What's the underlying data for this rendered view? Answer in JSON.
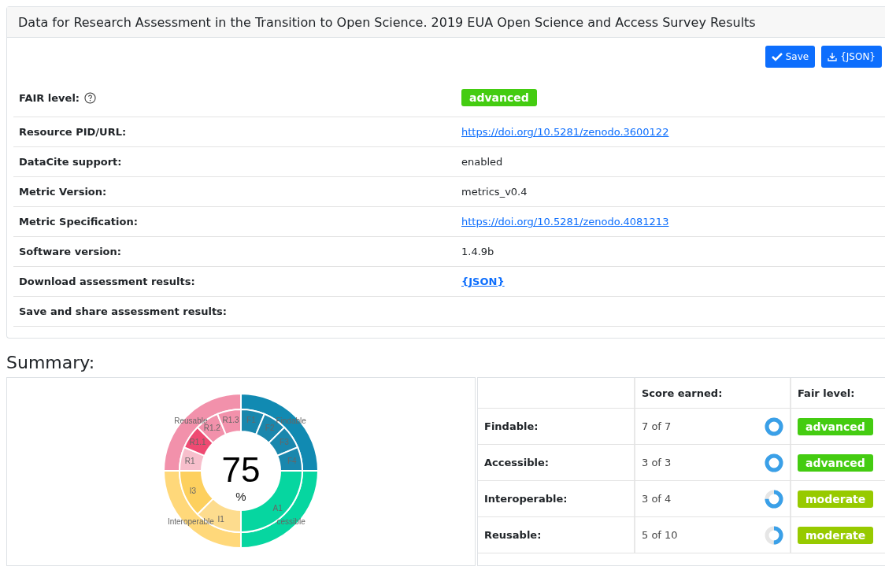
{
  "card_title": "Data for Research Assessment in the Transition to Open Science. 2019 EUA Open Science and Access Survey Results",
  "buttons": [
    {
      "kind": "save",
      "label": "Save"
    },
    {
      "kind": "download",
      "label": "{JSON}"
    }
  ],
  "details": [
    {
      "label": "FAIR level:",
      "kind": "badge",
      "value": "advanced",
      "help": true,
      "color": "#44cc11"
    },
    {
      "label": "Resource PID/URL:",
      "kind": "link",
      "value": "https://doi.org/10.5281/zenodo.3600122"
    },
    {
      "label": "DataCite support:",
      "kind": "text",
      "value": "enabled"
    },
    {
      "label": "Metric Version:",
      "kind": "text",
      "value": "metrics_v0.4"
    },
    {
      "label": "Metric Specification:",
      "kind": "link",
      "value": "https://doi.org/10.5281/zenodo.4081213"
    },
    {
      "label": "Software version:",
      "kind": "text",
      "value": "1.4.9b"
    },
    {
      "label": "Download assessment results:",
      "kind": "bold-link",
      "value": "{JSON}"
    },
    {
      "label": "Save and share assessment results:",
      "kind": "empty"
    }
  ],
  "summary_heading": "Summary:",
  "sunburst": {
    "center_value": "75",
    "center_unit": "%",
    "groups": [
      {
        "label": "Reusable",
        "color": "#f291ab",
        "segments": [
          {
            "label": "R1",
            "color": "#f7bfcc"
          },
          {
            "label": "R1.1",
            "color": "#ee4a72"
          },
          {
            "label": "R1.2",
            "color": "#f291ab"
          },
          {
            "label": "R1.3",
            "color": "#f291ab"
          }
        ]
      },
      {
        "label": "Findable",
        "color": "#118ab2",
        "segments": [
          {
            "label": "F1",
            "color": "#1a87ad"
          },
          {
            "label": "F2",
            "color": "#1a87ad"
          },
          {
            "label": "F3",
            "color": "#1a87ad"
          },
          {
            "label": "F4",
            "color": "#1a87ad"
          }
        ]
      },
      {
        "label": "Interoperable",
        "color": "#ffd87a",
        "segments": [
          {
            "label": "I1",
            "color": "#fddc8e"
          },
          {
            "label": "I3",
            "color": "#fdd05e"
          }
        ]
      },
      {
        "label": "cessible",
        "color": "#06d6a0",
        "segments": [
          {
            "label": "A1",
            "color": "#06d6a0"
          }
        ]
      }
    ]
  },
  "score_table": {
    "columns": [
      "Score earned:",
      "Fair level:"
    ],
    "rows": [
      {
        "name": "Findable:",
        "score": "7 of 7",
        "level": 1,
        "fair_level": "advanced",
        "color": "#44cc11"
      },
      {
        "name": "Accessible:",
        "score": "3 of 3",
        "level": 1,
        "fair_level": "advanced",
        "color": "#44cc11"
      },
      {
        "name": "Interoperable:",
        "score": "3 of 4",
        "level": 0.75,
        "fair_level": "moderate",
        "color": "#97ca00"
      },
      {
        "name": "Reusable:",
        "score": "5 of 10",
        "level": 0.5,
        "fair_level": "moderate",
        "color": "#97ca00"
      }
    ]
  }
}
